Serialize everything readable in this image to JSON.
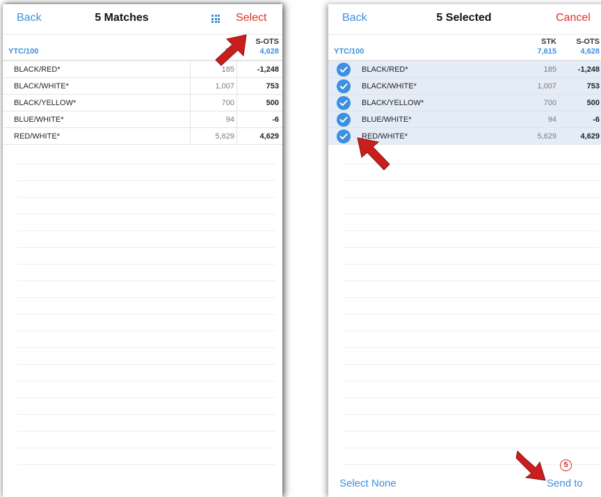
{
  "left_screen": {
    "back_label": "Back",
    "title": "5 Matches",
    "grid_icon": "grid-icon",
    "select_label": "Select",
    "summary": {
      "label": "YTC/100",
      "stk_header": "S",
      "stk_total": "7,6",
      "sots_header": "S-OTS",
      "sots_total": "4,628"
    },
    "rows": [
      {
        "name": "BLACK/RED*",
        "stk": "185",
        "sots": "-1,248"
      },
      {
        "name": "BLACK/WHITE*",
        "stk": "1,007",
        "sots": "753"
      },
      {
        "name": "BLACK/YELLOW*",
        "stk": "700",
        "sots": "500"
      },
      {
        "name": "BLUE/WHITE*",
        "stk": "94",
        "sots": "-6"
      },
      {
        "name": "RED/WHITE*",
        "stk": "5,629",
        "sots": "4,629"
      }
    ]
  },
  "right_screen": {
    "back_label": "Back",
    "title": "5 Selected",
    "cancel_label": "Cancel",
    "summary": {
      "label": "YTC/100",
      "stk_header": "STK",
      "stk_total": "7,615",
      "sots_header": "S-OTS",
      "sots_total": "4,628"
    },
    "rows": [
      {
        "name": "BLACK/RED*",
        "stk": "185",
        "sots": "-1,248",
        "selected": true
      },
      {
        "name": "BLACK/WHITE*",
        "stk": "1,007",
        "sots": "753",
        "selected": true
      },
      {
        "name": "BLACK/YELLOW*",
        "stk": "700",
        "sots": "500",
        "selected": true
      },
      {
        "name": "BLUE/WHITE*",
        "stk": "94",
        "sots": "-6",
        "selected": true
      },
      {
        "name": "RED/WHITE*",
        "stk": "5,629",
        "sots": "4,629",
        "selected": true
      }
    ],
    "bottom": {
      "select_none_label": "Select None",
      "send_to_label": "Send to",
      "step_badge": "5"
    }
  },
  "colors": {
    "accent_blue": "#3d8fe0",
    "select_red": "#e0302a",
    "annotation_red": "#c81e1e",
    "selected_row_bg": "#e3ecf7"
  }
}
